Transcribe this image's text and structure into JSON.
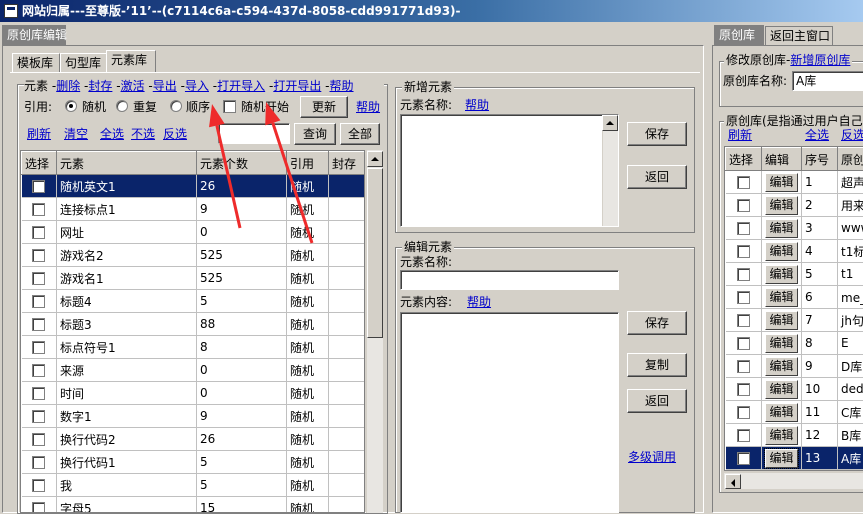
{
  "window": {
    "title": "网站归属---至尊版-’11’--(c7114c6a-c594-437d-8058-cdd991771d93)-"
  },
  "left_tabs": {
    "top": "原创库编辑",
    "tabs": [
      "模板库",
      "句型库",
      "元素库"
    ]
  },
  "element_group": {
    "title": "元素",
    "actions": [
      "删除",
      "封存",
      "激活",
      "导出",
      "导入",
      "打开导入",
      "打开导出",
      "帮助"
    ],
    "cite_label": "引用:",
    "cite_options": [
      "随机",
      "重复",
      "顺序"
    ],
    "cite_selected": "随机",
    "random_start_label": "随机开始",
    "update_button": "更新",
    "help_link": "帮助",
    "list_actions": [
      "刷新",
      "清空",
      "全选",
      "不选",
      "反选"
    ],
    "search_value": "",
    "query_button": "查询",
    "all_button": "全部"
  },
  "element_table": {
    "columns": [
      "选择",
      "元素",
      "元素个数",
      "引用",
      "封存"
    ],
    "rows": [
      {
        "name": "随机英文1",
        "count": "26",
        "cite": "随机",
        "sealed": "",
        "selected": true
      },
      {
        "name": "连接标点1",
        "count": "9",
        "cite": "随机",
        "sealed": ""
      },
      {
        "name": "网址",
        "count": "0",
        "cite": "随机",
        "sealed": ""
      },
      {
        "name": "游戏名2",
        "count": "525",
        "cite": "随机",
        "sealed": ""
      },
      {
        "name": "游戏名1",
        "count": "525",
        "cite": "随机",
        "sealed": ""
      },
      {
        "name": "标题4",
        "count": "5",
        "cite": "随机",
        "sealed": ""
      },
      {
        "name": "标题3",
        "count": "88",
        "cite": "随机",
        "sealed": ""
      },
      {
        "name": "标点符号1",
        "count": "8",
        "cite": "随机",
        "sealed": ""
      },
      {
        "name": "来源",
        "count": "0",
        "cite": "随机",
        "sealed": ""
      },
      {
        "name": "时间",
        "count": "0",
        "cite": "随机",
        "sealed": ""
      },
      {
        "name": "数字1",
        "count": "9",
        "cite": "随机",
        "sealed": ""
      },
      {
        "name": "换行代码2",
        "count": "26",
        "cite": "随机",
        "sealed": ""
      },
      {
        "name": "换行代码1",
        "count": "5",
        "cite": "随机",
        "sealed": ""
      },
      {
        "name": "我",
        "count": "5",
        "cite": "随机",
        "sealed": ""
      },
      {
        "name": "字母5",
        "count": "15",
        "cite": "随机",
        "sealed": ""
      }
    ]
  },
  "new_element": {
    "title": "新增元素",
    "name_label": "元素名称:",
    "help": "帮助",
    "save": "保存",
    "back": "返回"
  },
  "edit_element": {
    "title": "编辑元素",
    "name_label": "元素名称:",
    "name_value": "",
    "content_label": "元素内容:",
    "help": "帮助",
    "save": "保存",
    "copy": "复制",
    "back": "返回",
    "multi_link": "多级调用"
  },
  "right_tabs": {
    "tabs": [
      "原创库",
      "返回主窗口"
    ]
  },
  "modify_group": {
    "title": "修改原创库",
    "new_link": "新增原创库",
    "name_label": "原创库名称:",
    "name_value": "A库"
  },
  "lib_group": {
    "title": "原创库(是指通过用户自己",
    "actions": [
      "刷新",
      "全选",
      "反选"
    ],
    "columns": [
      "选择",
      "编辑",
      "序号",
      "原创库名称"
    ],
    "edit_label": "编辑",
    "rows": [
      {
        "no": "1",
        "name": "超声"
      },
      {
        "no": "2",
        "name": "用来"
      },
      {
        "no": "3",
        "name": "www."
      },
      {
        "no": "4",
        "name": "t1标"
      },
      {
        "no": "5",
        "name": "t1"
      },
      {
        "no": "6",
        "name": "me_新"
      },
      {
        "no": "7",
        "name": "jh句"
      },
      {
        "no": "8",
        "name": "E"
      },
      {
        "no": "9",
        "name": "D库"
      },
      {
        "no": "10",
        "name": "dede"
      },
      {
        "no": "11",
        "name": "C库"
      },
      {
        "no": "12",
        "name": "B库"
      },
      {
        "no": "13",
        "name": "A库",
        "selected": true
      }
    ]
  },
  "annotation": {
    "color": "#ee2b2b"
  }
}
